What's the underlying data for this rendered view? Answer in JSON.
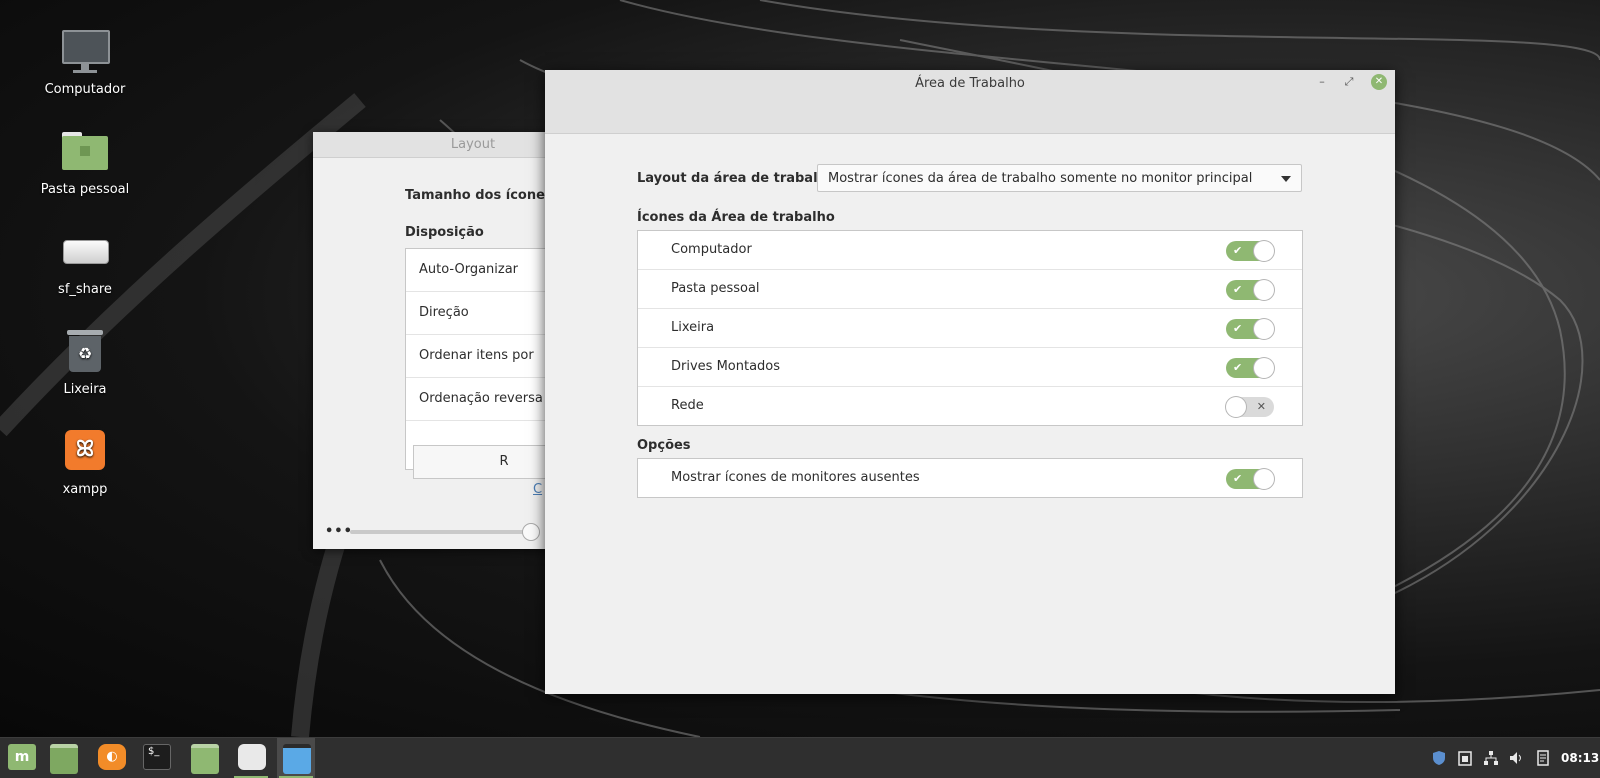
{
  "desktop": {
    "icons": [
      {
        "label": "Computador",
        "icon": "monitor-icon"
      },
      {
        "label": "Pasta pessoal",
        "icon": "home-folder-icon"
      },
      {
        "label": "sf_share",
        "icon": "drive-icon"
      },
      {
        "label": "Lixeira",
        "icon": "trash-icon"
      },
      {
        "label": "xampp",
        "icon": "xampp-icon"
      }
    ]
  },
  "layout_window": {
    "title": "Layout",
    "icon_size_label": "Tamanho dos ícones",
    "arrangement_label": "Disposição",
    "rows": [
      "Auto-Organizar",
      "Direção",
      "Ordenar itens por",
      "Ordenação reversa"
    ],
    "button_label": "R",
    "link_label": "C",
    "dots": "•••"
  },
  "main_window": {
    "title": "Área de Trabalho",
    "layout_label": "Layout da área de trabalho",
    "layout_value": "Mostrar ícones da área de trabalho somente no monitor principal",
    "icons_section_title": "Ícones da Área de trabalho",
    "icon_items": [
      {
        "label": "Computador",
        "on": true
      },
      {
        "label": "Pasta pessoal",
        "on": true
      },
      {
        "label": "Lixeira",
        "on": true
      },
      {
        "label": "Drives Montados",
        "on": true
      },
      {
        "label": "Rede",
        "on": false
      }
    ],
    "options_section_title": "Opções",
    "option_items": [
      {
        "label": "Mostrar ícones de monitores ausentes",
        "on": true
      }
    ],
    "toggle_on_mark": "✔",
    "toggle_off_mark": "✕"
  },
  "taskbar": {
    "apps": [
      "mint-menu-icon",
      "show-desktop-icon",
      "firefox-icon",
      "terminal-icon",
      "files-icon",
      "settings-icon",
      "desktop-settings-icon"
    ],
    "clock": "08:13",
    "accent": "#8fb872"
  }
}
